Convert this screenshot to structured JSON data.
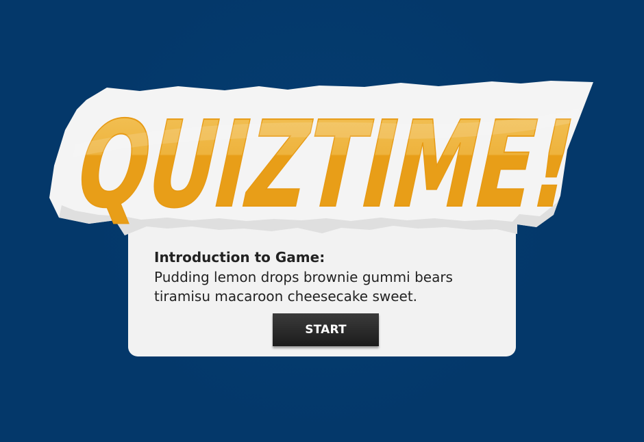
{
  "logo": {
    "text": "QUIZTIME!"
  },
  "intro": {
    "title": "Introduction to Game:",
    "line_1": "Pudding lemon drops brownie gummi bears",
    "line_2": "tiramisu macaroon cheesecake sweet."
  },
  "start_button": {
    "label": "START"
  },
  "colors": {
    "background": "#04386a",
    "card": "#f2f2f2",
    "logo_fill": "#eba21d",
    "logo_highlight": "#f2be55",
    "button": "#252525"
  }
}
